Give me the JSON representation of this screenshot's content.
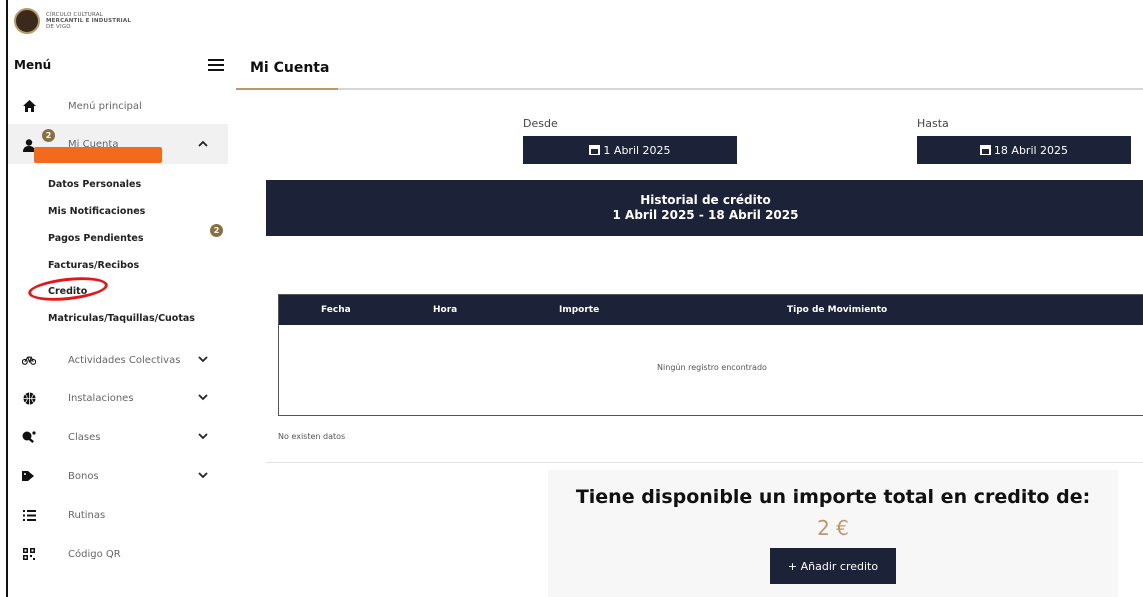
{
  "logo": {
    "text_line1": "CÍRCULO CULTURAL",
    "text_line2": "MERCANTIL E INDUSTRIAL",
    "text_line3": "DE VIGO"
  },
  "sidebar": {
    "menu_label": "Menú",
    "items": [
      {
        "label": "Menú principal",
        "icon": "home-icon"
      },
      {
        "label": "Mi Cuenta",
        "icon": "user-icon",
        "badge": "2"
      },
      {
        "label": "Actividades Colectivas",
        "icon": "bicycle-icon"
      },
      {
        "label": "Instalaciones",
        "icon": "ball-icon"
      },
      {
        "label": "Clases",
        "icon": "ping-pong-icon"
      },
      {
        "label": "Bonos",
        "icon": "tags-icon"
      },
      {
        "label": "Rutinas",
        "icon": "list-icon"
      },
      {
        "label": "Código QR",
        "icon": "qr-icon"
      }
    ],
    "sub_items": [
      "Datos Personales",
      "Mis Notificaciones",
      "Pagos Pendientes",
      "Facturas/Recibos",
      "Credito",
      "Matriculas/Taquillas/Cuotas"
    ],
    "pending_badge": "2"
  },
  "main": {
    "title": "Mi Cuenta",
    "desde_label": "Desde",
    "desde_value": "1 Abril 2025",
    "hasta_label": "Hasta",
    "hasta_value": "18 Abril 2025",
    "banner_title": "Historial de crédito",
    "banner_range": "1 Abril 2025 - 18 Abril 2025",
    "table": {
      "headers": [
        "Fecha",
        "Hora",
        "Importe",
        "Tipo de Movimiento"
      ],
      "empty_message": "Ningún registro encontrado"
    },
    "no_data": "No existen datos",
    "credit_title": "Tiene disponible un importe total en credito de:",
    "credit_amount": "2 €",
    "add_button": "+ Añadir credito"
  },
  "colors": {
    "navy": "#1c2238",
    "gold": "#b9996a",
    "highlight": "#e0181b",
    "redaction": "#f26b1d"
  }
}
